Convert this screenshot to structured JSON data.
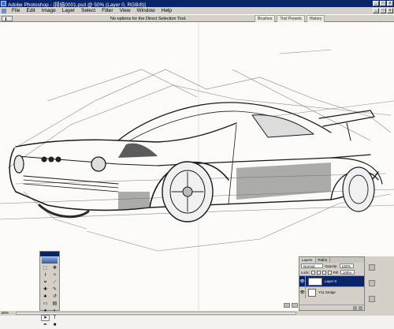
{
  "window": {
    "title": "Adobe Photoshop - [掃描0001.psd @ 50% (Layer 0, RGB/8)]",
    "controls": [
      "_",
      "□",
      "x"
    ]
  },
  "menubar": {
    "items": [
      "File",
      "Edit",
      "Image",
      "Layer",
      "Select",
      "Filter",
      "View",
      "Window",
      "Help"
    ],
    "doc_controls": [
      "_",
      "□",
      "x"
    ]
  },
  "options_bar": {
    "hint": "No options for the Direct Selection Tool."
  },
  "palette_well": {
    "tabs": [
      "Brushes",
      "Tool Presets",
      "History"
    ]
  },
  "status_bar": {
    "zoom": "50%"
  },
  "toolbox": {
    "tools": [
      {
        "icon": "marquee-icon",
        "glyph": "⬚"
      },
      {
        "icon": "move-icon",
        "glyph": "✥"
      },
      {
        "icon": "lasso-icon",
        "glyph": "ℓ"
      },
      {
        "icon": "magic-wand-icon",
        "glyph": "✧"
      },
      {
        "icon": "crop-icon",
        "glyph": "⌗"
      },
      {
        "icon": "slice-icon",
        "glyph": "⟋"
      },
      {
        "icon": "healing-brush-icon",
        "glyph": "✚"
      },
      {
        "icon": "brush-icon",
        "glyph": "✎"
      },
      {
        "icon": "clone-stamp-icon",
        "glyph": "♣"
      },
      {
        "icon": "history-brush-icon",
        "glyph": "↺"
      },
      {
        "icon": "eraser-icon",
        "glyph": "▭"
      },
      {
        "icon": "gradient-icon",
        "glyph": "▤"
      },
      {
        "icon": "blur-icon",
        "glyph": "●"
      },
      {
        "icon": "dodge-icon",
        "glyph": "◐"
      },
      {
        "icon": "path-selection-icon",
        "glyph": "➤"
      },
      {
        "icon": "type-icon",
        "glyph": "T"
      },
      {
        "icon": "pen-icon",
        "glyph": "✒"
      },
      {
        "icon": "shape-icon",
        "glyph": "■"
      }
    ],
    "active_tool": "path-selection-icon"
  },
  "layers_panel": {
    "tabs": [
      "Layers",
      "Paths"
    ],
    "blend_mode": "Normal",
    "opacity_label": "Opacity:",
    "opacity_value": "100%",
    "lock_label": "Lock:",
    "fill_label": "Fill:",
    "fill_value": "100%",
    "layers": [
      {
        "name": "Layer 0",
        "selected": true
      },
      {
        "name": "Y11 Sedge",
        "selected": false
      }
    ]
  },
  "colors": {
    "title_bar": "#0a246a",
    "chrome": "#d4d0c8",
    "canvas": "#fbfaf7"
  }
}
